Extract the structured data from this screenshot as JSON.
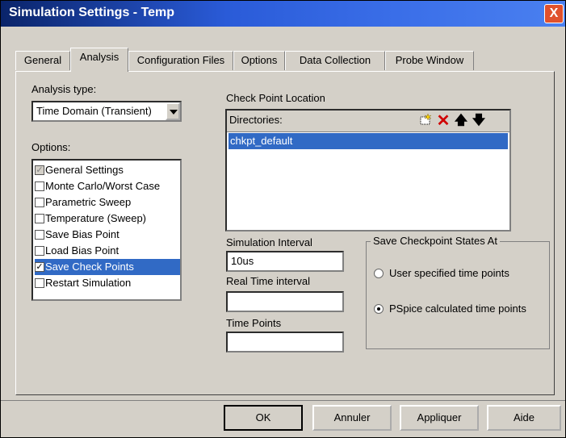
{
  "window": {
    "title": "Simulation Settings - Temp",
    "close_label": "X"
  },
  "tabs": [
    {
      "label": "General"
    },
    {
      "label": "Analysis"
    },
    {
      "label": "Configuration Files"
    },
    {
      "label": "Options"
    },
    {
      "label": "Data Collection"
    },
    {
      "label": "Probe Window"
    }
  ],
  "active_tab": "Analysis",
  "analysis": {
    "type_label": "Analysis type:",
    "type_value": "Time Domain (Transient)",
    "options_label": "Options:",
    "options": [
      {
        "label": "General Settings",
        "checked": true,
        "disabled": true,
        "selected": false
      },
      {
        "label": "Monte Carlo/Worst Case",
        "checked": false,
        "selected": false
      },
      {
        "label": "Parametric Sweep",
        "checked": false,
        "selected": false
      },
      {
        "label": "Temperature (Sweep)",
        "checked": false,
        "selected": false
      },
      {
        "label": "Save Bias Point",
        "checked": false,
        "selected": false
      },
      {
        "label": "Load Bias Point",
        "checked": false,
        "selected": false
      },
      {
        "label": "Save Check Points",
        "checked": true,
        "selected": true
      },
      {
        "label": "Restart Simulation",
        "checked": false,
        "selected": false
      }
    ]
  },
  "checkpoint": {
    "location_label": "Check Point Location",
    "directories_label": "Directories:",
    "directories": [
      "chkpt_default"
    ],
    "icons": [
      "new-folder-icon",
      "delete-icon",
      "move-up-icon",
      "move-down-icon"
    ],
    "sim_interval_label": "Simulation Interval",
    "sim_interval_value": "10us",
    "real_time_label": "Real Time interval",
    "real_time_value": "",
    "time_points_label": "Time Points",
    "time_points_value": "",
    "save_states_label": "Save Checkpoint States At",
    "radio_user": "User specified time points",
    "radio_pspice": "PSpice calculated time points",
    "radio_selected": "pspice"
  },
  "buttons": {
    "ok": "OK",
    "cancel": "Annuler",
    "apply": "Appliquer",
    "help": "Aide"
  },
  "colors": {
    "title_bar": "#0a246a",
    "selection": "#316ac5",
    "close": "#e0512d",
    "face": "#d4d0c8"
  }
}
